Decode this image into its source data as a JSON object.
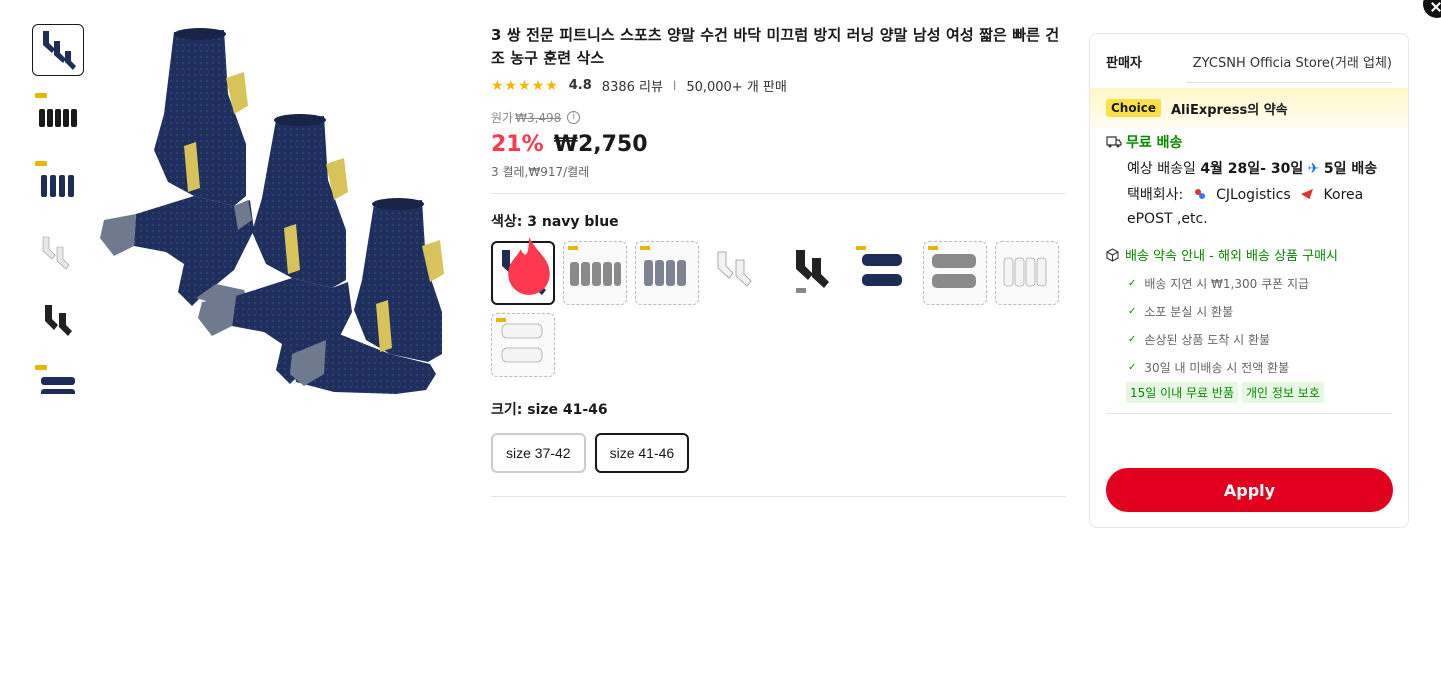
{
  "product": {
    "title": "3 쌍 전문 피트니스 스포츠 양말 수건 바닥 미끄럼 방지 러닝 양말 남성 여성 짧은 빠른 건조 농구 훈련 삭스",
    "stars": "★★★★★",
    "rating": "4.8",
    "reviews": "8386 리뷰",
    "sold": "50,000+ 개 판매",
    "original_label": "원가",
    "original_price": "₩3,498",
    "discount": "21%",
    "price": "₩2,750",
    "unit_price": "3 켤레,₩917/켤레"
  },
  "color": {
    "label": "색상: 3 navy blue",
    "options": [
      "3 navy blue",
      "gray 1",
      "gray 2",
      "white 1",
      "black",
      "navy 6",
      "gray 6",
      "white 2",
      "white 6"
    ]
  },
  "size": {
    "label": "크기: size 41-46",
    "options": [
      "size 37-42",
      "size 41-46"
    ],
    "selected": "size 41-46"
  },
  "seller": {
    "label": "판매자",
    "name": "ZYCSNH Officia Store(거래 업체)"
  },
  "choice": {
    "tag": "Choice",
    "text": "AliExpress의 약속"
  },
  "shipping": {
    "title": "무료 배송",
    "delivery_prefix": "예상 배송일 ",
    "delivery_dates": "4월 28일- 30일",
    "delivery_fast": "5일 배송",
    "courier_label": "택배회사:",
    "courier_1": "CJLogistics",
    "courier_2": "Korea ePOST ,etc."
  },
  "promise": {
    "title": "배송 약속 안내 - 해외 배송 상품 구매시",
    "items": [
      "배송 지연 시 ₩1,300 쿠폰 지급",
      "소포 분실 시 환불",
      "손상된 상품 도착 시 환불",
      "30일 내 미배송 시 전액 환불"
    ],
    "tags": [
      "15일 이내 무료 반품",
      "개인 정보 보호"
    ]
  },
  "apply_label": "Apply",
  "colors": {
    "accent": "#e1001d",
    "discount": "#fd384f",
    "green": "#0a8800",
    "star": "#fdb400"
  }
}
